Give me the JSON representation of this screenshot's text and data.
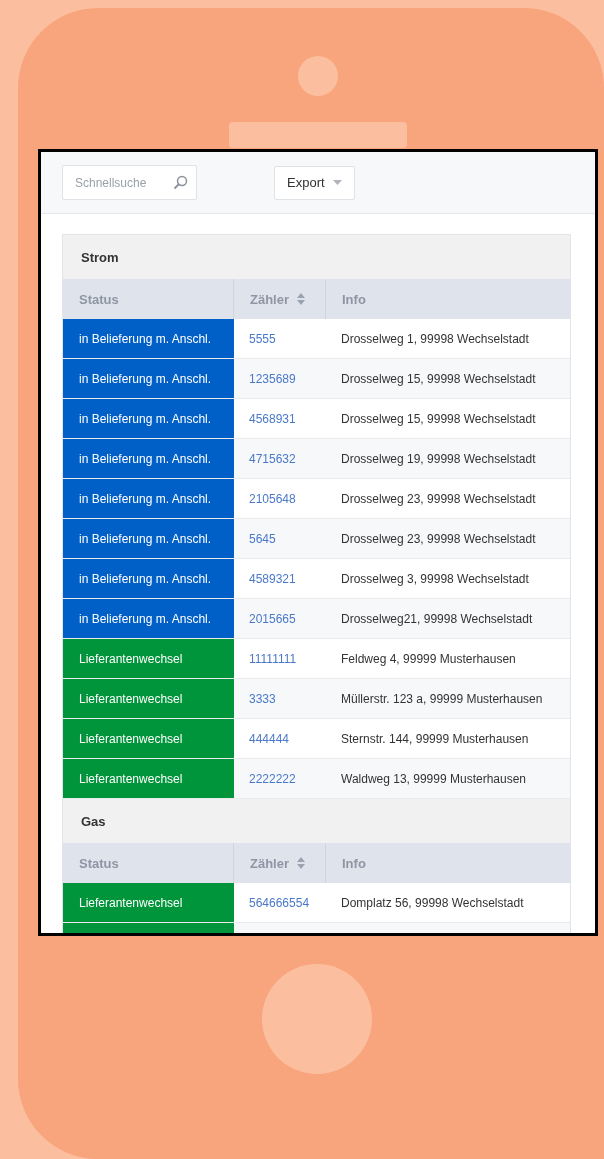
{
  "toolbar": {
    "search": {
      "placeholder": "Schnellsuche"
    },
    "export_button": {
      "label": "Export"
    }
  },
  "sections": [
    {
      "title": "Strom",
      "columns": [
        {
          "label": "Status",
          "sortable": false
        },
        {
          "label": "Zähler",
          "sortable": true
        },
        {
          "label": "Info",
          "sortable": false
        }
      ],
      "rows": [
        {
          "status": "in Belieferung m. Anschl.",
          "color": "#0060c8",
          "meter": "5555",
          "info": "Drosselweg 1, 99998 Wechselstadt"
        },
        {
          "status": "in Belieferung m. Anschl.",
          "color": "#0060c8",
          "meter": "1235689",
          "info": "Drosselweg 15, 99998 Wechselstadt"
        },
        {
          "status": "in Belieferung m. Anschl.",
          "color": "#0060c8",
          "meter": "4568931",
          "info": "Drosselweg 15, 99998 Wechselstadt"
        },
        {
          "status": "in Belieferung m. Anschl.",
          "color": "#0060c8",
          "meter": "4715632",
          "info": "Drosselweg 19, 99998 Wechselstadt"
        },
        {
          "status": "in Belieferung m. Anschl.",
          "color": "#0060c8",
          "meter": "2105648",
          "info": "Drosselweg 23, 99998 Wechselstadt"
        },
        {
          "status": "in Belieferung m. Anschl.",
          "color": "#0060c8",
          "meter": "5645",
          "info": "Drosselweg 23, 99998 Wechselstadt"
        },
        {
          "status": "in Belieferung m. Anschl.",
          "color": "#0060c8",
          "meter": "4589321",
          "info": "Drosselweg 3, 99998 Wechselstadt"
        },
        {
          "status": "in Belieferung m. Anschl.",
          "color": "#0060c8",
          "meter": "2015665",
          "info": "Drosselweg21, 99998 Wechselstadt"
        },
        {
          "status": "Lieferantenwechsel",
          "color": "#00953a",
          "meter": "11111111",
          "info": "Feldweg 4, 99999 Musterhausen"
        },
        {
          "status": "Lieferantenwechsel",
          "color": "#00953a",
          "meter": "3333",
          "info": "Müllerstr. 123 a, 99999 Musterhausen"
        },
        {
          "status": "Lieferantenwechsel",
          "color": "#00953a",
          "meter": "444444",
          "info": "Sternstr. 144, 99999 Musterhausen"
        },
        {
          "status": "Lieferantenwechsel",
          "color": "#00953a",
          "meter": "2222222",
          "info": "Waldweg 13, 99999 Musterhausen"
        }
      ]
    },
    {
      "title": "Gas",
      "columns": [
        {
          "label": "Status",
          "sortable": false
        },
        {
          "label": "Zähler",
          "sortable": true
        },
        {
          "label": "Info",
          "sortable": false
        }
      ],
      "rows": [
        {
          "status": "Lieferantenwechsel",
          "color": "#00953a",
          "meter": "564666554",
          "info": "Domplatz 56, 99998 Wechselstadt"
        },
        {
          "color": "#00953a"
        }
      ]
    }
  ]
}
